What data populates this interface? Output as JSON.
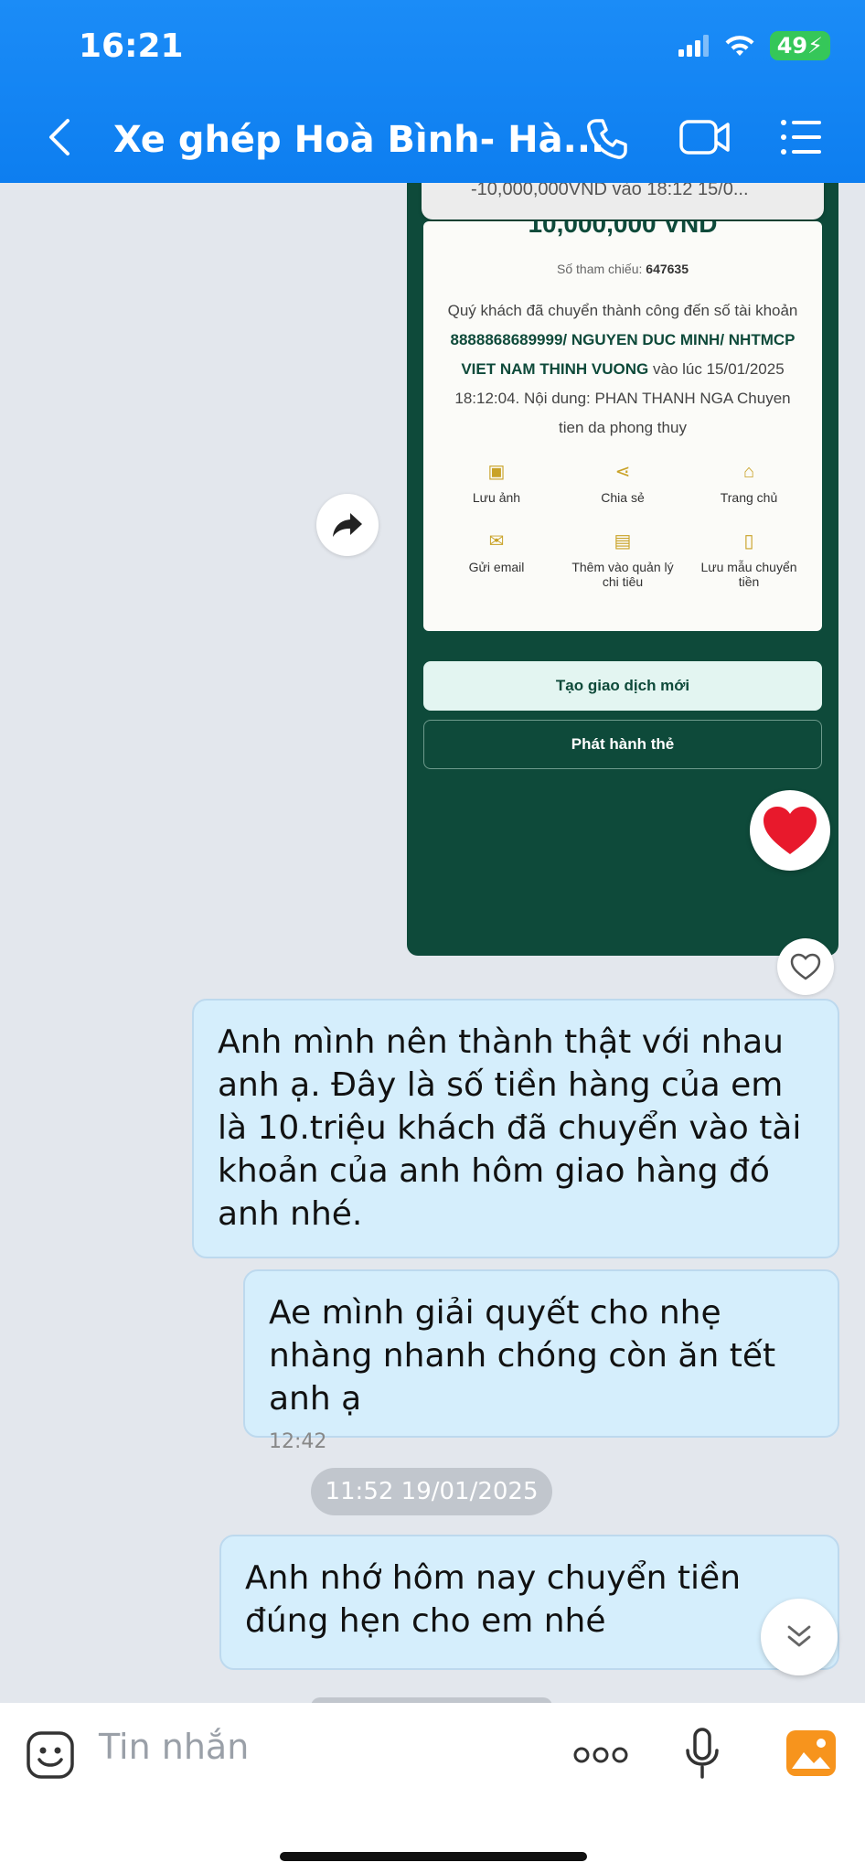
{
  "status_bar": {
    "time": "16:21",
    "battery": "49"
  },
  "header": {
    "title": "Xe ghép Hoà Bình- Hà..."
  },
  "receipt": {
    "top_snippet": "-10,000,000VND vào 18:12 15/0...",
    "amount": "10,000,000 VND",
    "ref_label": "Số tham chiếu:",
    "ref_number": "647635",
    "msg_prefix": "Quý khách đã chuyển thành công đến số tài khoản",
    "msg_account": "8888868689999/ NGUYEN DUC MINH/ NHTMCP VIET NAM THINH VUONG",
    "msg_suffix": "vào lúc 15/01/2025 18:12:04. Nội dung: PHAN THANH NGA Chuyen tien da phong thuy",
    "actions": {
      "save_image": "Lưu ảnh",
      "share": "Chia sẻ",
      "home": "Trang chủ",
      "send_email": "Gửi email",
      "add_expense": "Thêm vào quản lý chi tiêu",
      "save_template": "Lưu mẫu chuyển tiền"
    },
    "new_transaction": "Tạo giao dịch mới",
    "issue_card": "Phát hành thẻ"
  },
  "messages": {
    "m1": "Anh mình nên thành thật với nhau anh ạ. Đây là số tiền hàng của em là 10.triệu khách đã chuyển vào tài khoản của anh hôm giao hàng đó anh nhé.",
    "m2": "Ae mình giải quyết cho nhẹ nhàng nhanh chóng còn ăn tết anh ạ",
    "m2_time": "12:42",
    "date_separator": "11:52 19/01/2025",
    "m3": "Anh nhớ hôm nay chuyển tiền đúng hẹn cho em nhé"
  },
  "input": {
    "placeholder": "Tin nhắn"
  },
  "colors": {
    "header": "#1b8cf7",
    "bubble": "#d5eefc",
    "receipt_green": "#0e4a3a",
    "heart": "#e8192c"
  }
}
